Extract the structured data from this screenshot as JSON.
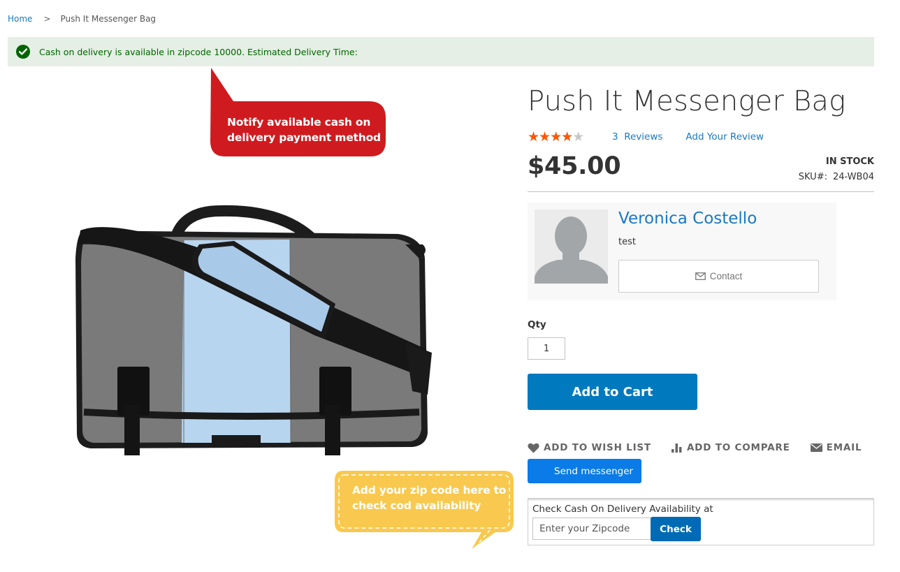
{
  "breadcrumb": {
    "home": "Home",
    "separator": ">",
    "current": "Push It Messenger Bag"
  },
  "notice": {
    "icon": "check-circle-icon",
    "text": "Cash on delivery is available in zipcode 10000. Estimated Delivery Time:",
    "color": "#006400",
    "background": "#e5efe5"
  },
  "annotations": {
    "red_callout": "Notify available cash on delivery payment method",
    "red_callout_color": "#cf1b1f",
    "yellow_callout": "Add your zip code here to check cod availability",
    "yellow_callout_color": "#f8c94e"
  },
  "product": {
    "title": "Push It Messenger Bag",
    "rating": {
      "value": 3.5,
      "max": 5
    },
    "reviews_count": "3",
    "reviews_label": "Reviews",
    "add_review_label": "Add Your Review",
    "price": "$45.00",
    "stock_status": "IN STOCK",
    "sku_label": "SKU#:",
    "sku": "24-WB04",
    "image_alt": "Push It Messenger Bag product image"
  },
  "seller": {
    "name": "Veronica Costello",
    "description": "test",
    "contact_label": "Contact"
  },
  "purchase": {
    "qty_label": "Qty",
    "qty_value": "1",
    "add_to_cart_label": "Add to Cart",
    "accent_color": "#0079be"
  },
  "actions": {
    "wishlist": "ADD TO WISH LIST",
    "compare": "ADD TO COMPARE",
    "email": "EMAIL",
    "send_messenger": "Send messenger"
  },
  "cod": {
    "label": "Check Cash On Delivery Availability at",
    "zip_placeholder": "Enter your Zipcode",
    "zip_value": "",
    "check_label": "Check"
  }
}
